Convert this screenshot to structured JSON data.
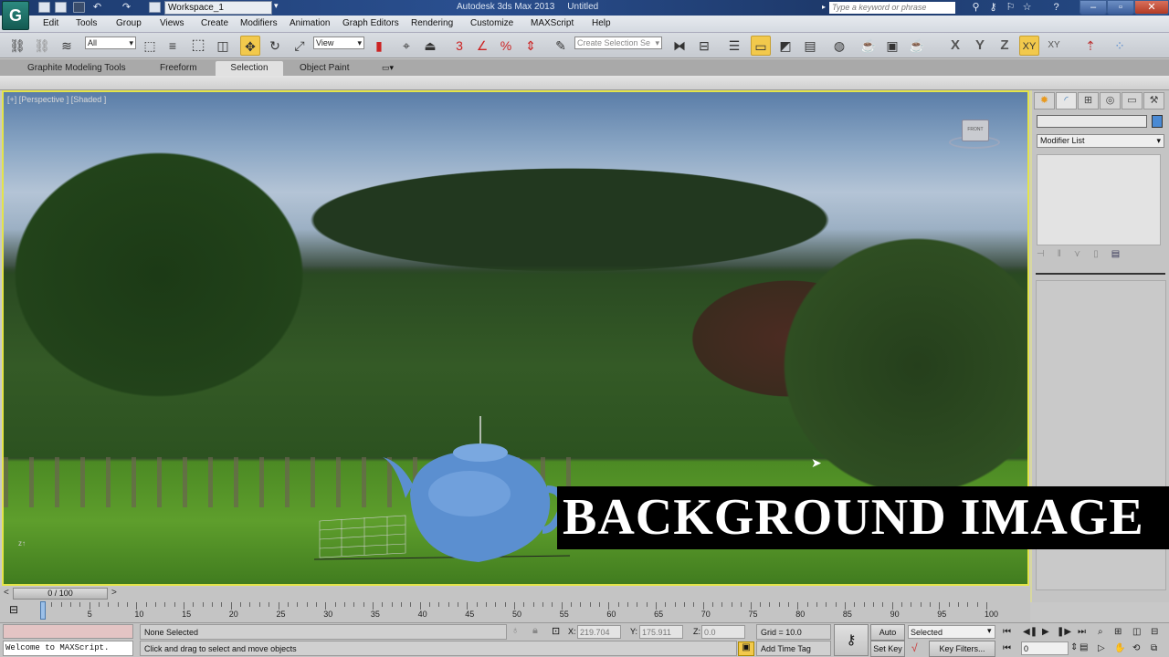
{
  "titlebar": {
    "app_name": "Autodesk 3ds Max  2013",
    "document": "Untitled",
    "workspace": "Workspace_1",
    "search_placeholder": "Type a keyword or phrase",
    "logo_letter": "G"
  },
  "menu": [
    "Edit",
    "Tools",
    "Group",
    "Views",
    "Create",
    "Modifiers",
    "Animation",
    "Graph Editors",
    "Rendering",
    "Customize",
    "MAXScript",
    "Help"
  ],
  "toolbar": {
    "selection_filter": "All",
    "reference_coord": "View",
    "named_selection_placeholder": "Create Selection Se",
    "axis_buttons": [
      "X",
      "Y",
      "Z",
      "XY",
      "XY"
    ],
    "snap_label": "3",
    "angle_snap_label": "%"
  },
  "ribbon": {
    "tabs": [
      "Graphite Modeling Tools",
      "Freeform",
      "Selection",
      "Object Paint"
    ],
    "active_tab": "Selection"
  },
  "viewport": {
    "label": "[+] [Perspective ] [Shaded ]",
    "viewcube_label": "FRONT",
    "overlay_text": "BACKGROUND IMAGE",
    "teapot_color": "#5b8fd0"
  },
  "command_panel": {
    "modifier_list": "Modifier List",
    "object_color": "#4a8ad4"
  },
  "timeline": {
    "slider_label": "0 / 100",
    "prev": "<",
    "next": ">",
    "ticks": [
      0,
      5,
      10,
      15,
      20,
      25,
      30,
      35,
      40,
      45,
      50,
      55,
      60,
      65,
      70,
      75,
      80,
      85,
      90,
      95,
      100
    ]
  },
  "status": {
    "maxscript_output": "Welcome to MAXScript.",
    "selection": "None Selected",
    "prompt": "Click and drag to select and move objects",
    "x_label": "X:",
    "x": "219.704",
    "y_label": "Y:",
    "y": "175.911",
    "z_label": "Z:",
    "z": "0.0",
    "grid": "Grid = 10.0",
    "add_time_tag": "Add Time Tag",
    "auto_key": "Auto Key",
    "set_key": "Set Key",
    "key_mode": "Selected",
    "key_filters": "Key Filters...",
    "current_frame": "0"
  },
  "colors": {
    "active_viewport_border": "#e4e44a",
    "active_tool": "#f2c94c",
    "titlebar": "#1d3b6e"
  }
}
